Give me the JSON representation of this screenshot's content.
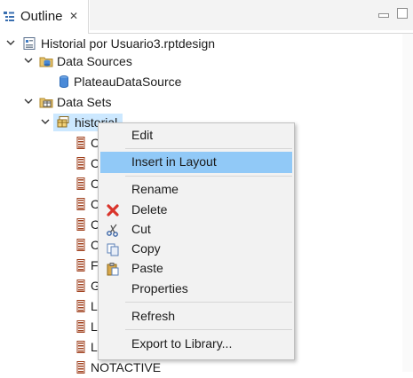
{
  "view": {
    "tab_label": "Outline",
    "close_glyph": "✕",
    "icon": "outline-icon"
  },
  "tree": {
    "root": {
      "label": "Historial por Usuario3.rptdesign",
      "icon": "report-design-icon"
    },
    "data_sources": {
      "label": "Data Sources",
      "icon": "data-sources-folder-icon"
    },
    "plateau": {
      "label": "PlateauDataSource",
      "icon": "database-icon"
    },
    "data_sets": {
      "label": "Data Sets",
      "icon": "data-sets-folder-icon"
    },
    "historial": {
      "label": "historial",
      "icon": "dataset-icon",
      "selected": true
    },
    "columns": [
      {
        "label": "C"
      },
      {
        "label": "C"
      },
      {
        "label": "C"
      },
      {
        "label": "C"
      },
      {
        "label": "C"
      },
      {
        "label": "C"
      },
      {
        "label": "F"
      },
      {
        "label": "G"
      },
      {
        "label": "L"
      },
      {
        "label": "L"
      },
      {
        "label": "L"
      },
      {
        "label": "NOTACTIVE"
      }
    ]
  },
  "context_menu": {
    "items": {
      "edit": "Edit",
      "insert_in_layout": "Insert in Layout",
      "rename": "Rename",
      "delete": "Delete",
      "cut": "Cut",
      "copy": "Copy",
      "paste": "Paste",
      "properties": "Properties",
      "refresh": "Refresh",
      "export_to_library": "Export to Library..."
    },
    "highlighted": "insert_in_layout"
  },
  "colors": {
    "selection": "#cce8ff",
    "menu_highlight": "#91c9f7",
    "menu_background": "#f2f2f2",
    "delete_icon": "#d9342b"
  }
}
